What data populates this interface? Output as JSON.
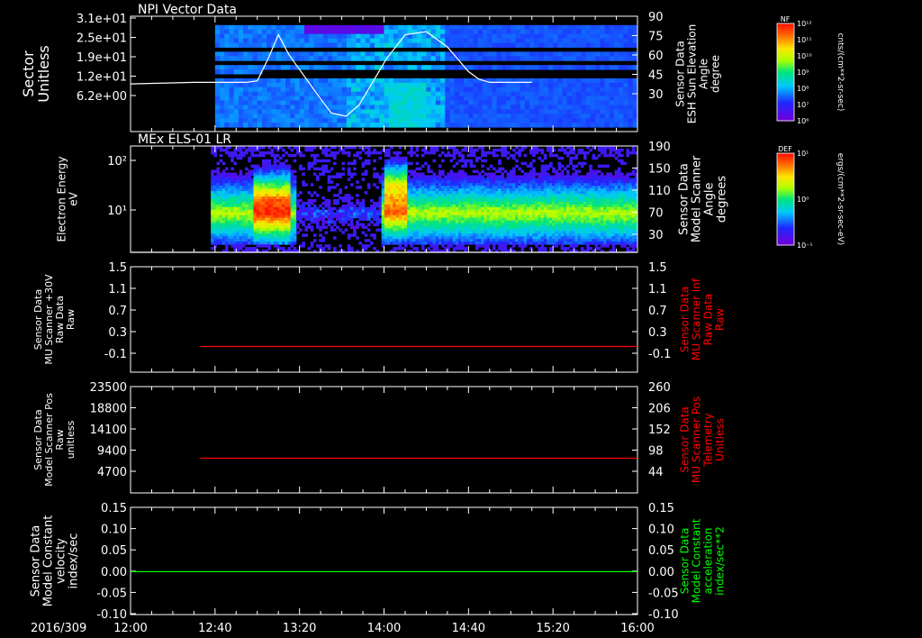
{
  "date_label": "2016/309",
  "time_ticks": [
    "12:00",
    "12:40",
    "13:20",
    "14:00",
    "14:40",
    "15:20",
    "16:00"
  ],
  "x_range_min": [
    0,
    240
  ],
  "chart_data": [
    {
      "type": "heatmap",
      "title": "NPI Vector Data",
      "ylabel_left": [
        "Sector",
        "Unitless"
      ],
      "ylabel_right": [
        "Sensor Data",
        "ESH Sun Elevation",
        "Angle",
        "degree"
      ],
      "left_ticks": [
        "3.1e+01",
        "2.5e+01",
        "1.9e+01",
        "1.2e+01",
        "6.2e+00"
      ],
      "right_ticks": [
        "90",
        "75",
        "60",
        "45",
        "30"
      ],
      "right_range": [
        15,
        90
      ],
      "data_start_min": 40,
      "overlay_line": {
        "color": "#ffffff",
        "x": [
          0,
          30,
          55,
          60,
          65,
          70,
          75,
          88,
          95,
          102,
          108,
          115,
          121,
          130,
          140,
          150,
          160,
          165,
          170,
          175,
          180,
          185,
          190
        ],
        "y": [
          46,
          47,
          47,
          48,
          62,
          78,
          65,
          40,
          27,
          25,
          32,
          48,
          62,
          78,
          80,
          70,
          54,
          49,
          47,
          47,
          47,
          47,
          47
        ]
      },
      "colorbar": {
        "title": "NF",
        "units": "cnts/(cm**2-sr-sec)",
        "labels": [
          "10¹²",
          "10¹¹",
          "10¹⁰",
          "10⁹",
          "10⁸",
          "10⁷",
          "10⁶"
        ]
      }
    },
    {
      "type": "heatmap",
      "title": "MEx ELS-01 LR",
      "ylabel_left": [
        "Electron Energy",
        "eV"
      ],
      "ylabel_right": [
        "Sensor Data",
        "Model Scanner",
        "Angle",
        "degrees"
      ],
      "left_ticks": [
        "10²",
        "10¹"
      ],
      "right_ticks": [
        "190",
        "150",
        "110",
        "70",
        "30"
      ],
      "right_range": [
        10,
        190
      ],
      "data_start_min": 38,
      "overlay_line": {
        "color": "#ffffff",
        "x": [
          0,
          240
        ],
        "y": [
          10,
          10
        ]
      },
      "colorbar": {
        "title": "DEF",
        "units": "ergs/(cm**2-sr-sec-eV)",
        "labels": [
          "10¹",
          "10⁰",
          "10⁻¹"
        ]
      }
    },
    {
      "type": "line",
      "ylabel_left": [
        "Sensor Data",
        "MU Scanner +30V",
        "Raw Data",
        "Raw"
      ],
      "ylabel_right": [
        "Sensor Data",
        "MU Scanner Inf",
        "Raw Data",
        "Raw"
      ],
      "right_color": "#ff0000",
      "left_ticks": [
        "1.5",
        "1.1",
        "0.7",
        "0.3",
        "-0.1"
      ],
      "right_ticks": [
        "1.5",
        "1.1",
        "0.7",
        "0.3",
        "-0.1"
      ],
      "ylim": [
        -0.35,
        1.5
      ],
      "series": [
        {
          "color": "#ff0000",
          "x": [
            33,
            240
          ],
          "y": [
            0.1,
            0.1
          ]
        }
      ]
    },
    {
      "type": "line",
      "ylabel_left": [
        "Sensor Data",
        "Model Scanner Pos",
        "Raw",
        "unitless"
      ],
      "ylabel_right": [
        "Sensor Data",
        "MU Scanner Pos",
        "Telemetry",
        "Unitless"
      ],
      "right_color": "#ff0000",
      "left_ticks": [
        "23500",
        "18800",
        "14100",
        "9400",
        "4700"
      ],
      "right_ticks": [
        "260",
        "206",
        "152",
        "98",
        "44"
      ],
      "ylim": [
        500,
        23500
      ],
      "series": [
        {
          "color": "#ff0000",
          "x": [
            33,
            240
          ],
          "y": [
            8000,
            8000
          ]
        }
      ]
    },
    {
      "type": "line",
      "ylabel_left": [
        "Sensor Data",
        "Model Constant",
        "velocity",
        "index/sec"
      ],
      "ylabel_right": [
        "Sensor Data",
        "Model Constant",
        "acceleration",
        "index/sec**2"
      ],
      "right_color": "#00ff00",
      "left_ticks": [
        "0.15",
        "0.10",
        "0.05",
        "0.00",
        "-0.05",
        "-0.10"
      ],
      "right_ticks": [
        "0.15",
        "0.10",
        "0.05",
        "0.00",
        "-0.05",
        "-0.10"
      ],
      "ylim": [
        -0.1,
        0.15
      ],
      "series": [
        {
          "color": "#00ff00",
          "x": [
            0,
            240
          ],
          "y": [
            0,
            0
          ]
        }
      ]
    }
  ]
}
